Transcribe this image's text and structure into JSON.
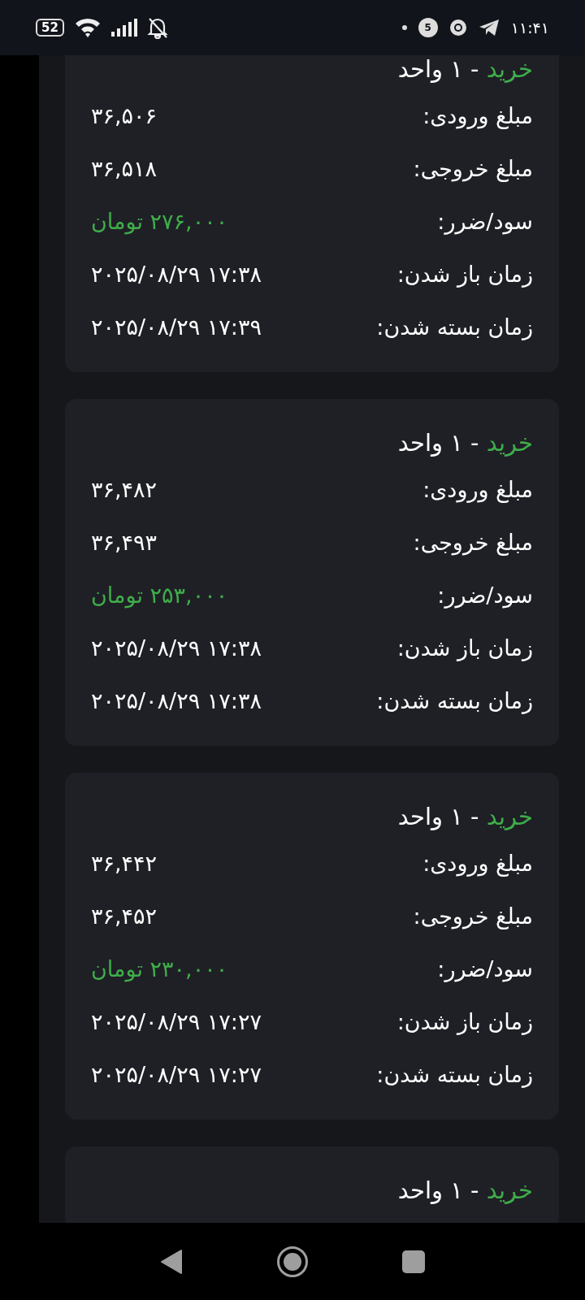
{
  "status_bar": {
    "battery": "52",
    "time": "۱۱:۴۱",
    "app_badge": "5"
  },
  "trades": [
    {
      "side": {
        "text": "خرید",
        "color": "#3fae4a"
      },
      "quantity": "- ۱ واحد",
      "rows": [
        {
          "label": "مبلغ ورودی:",
          "value": "۳۶,۵۰۶",
          "kind": "plain"
        },
        {
          "label": "مبلغ خروجی:",
          "value": "۳۶,۵۱۸",
          "kind": "plain"
        },
        {
          "label": "سود/ضرر:",
          "value": "۲۷۶,۰۰۰ تومان",
          "kind": "profit"
        },
        {
          "label": "زمان باز شدن:",
          "value": "۲۰۲۵/۰۸/۲۹ ۱۷:۳۸",
          "kind": "plain"
        },
        {
          "label": "زمان بسته شدن:",
          "value": "۲۰۲۵/۰۸/۲۹ ۱۷:۳۹",
          "kind": "plain"
        }
      ]
    },
    {
      "side": {
        "text": "خرید",
        "color": "#3fae4a"
      },
      "quantity": "- ۱ واحد",
      "rows": [
        {
          "label": "مبلغ ورودی:",
          "value": "۳۶,۴۸۲",
          "kind": "plain"
        },
        {
          "label": "مبلغ خروجی:",
          "value": "۳۶,۴۹۳",
          "kind": "plain"
        },
        {
          "label": "سود/ضرر:",
          "value": "۲۵۳,۰۰۰ تومان",
          "kind": "profit"
        },
        {
          "label": "زمان باز شدن:",
          "value": "۲۰۲۵/۰۸/۲۹ ۱۷:۳۸",
          "kind": "plain"
        },
        {
          "label": "زمان بسته شدن:",
          "value": "۲۰۲۵/۰۸/۲۹ ۱۷:۳۸",
          "kind": "plain"
        }
      ]
    },
    {
      "side": {
        "text": "خرید",
        "color": "#3fae4a"
      },
      "quantity": "- ۱ واحد",
      "rows": [
        {
          "label": "مبلغ ورودی:",
          "value": "۳۶,۴۴۲",
          "kind": "plain"
        },
        {
          "label": "مبلغ خروجی:",
          "value": "۳۶,۴۵۲",
          "kind": "plain"
        },
        {
          "label": "سود/ضرر:",
          "value": "۲۳۰,۰۰۰ تومان",
          "kind": "profit"
        },
        {
          "label": "زمان باز شدن:",
          "value": "۲۰۲۵/۰۸/۲۹ ۱۷:۲۷",
          "kind": "plain"
        },
        {
          "label": "زمان بسته شدن:",
          "value": "۲۰۲۵/۰۸/۲۹ ۱۷:۲۷",
          "kind": "plain"
        }
      ]
    },
    {
      "side": {
        "text": "خرید",
        "color": "#3fae4a"
      },
      "quantity": "- ۱ واحد"
    }
  ]
}
